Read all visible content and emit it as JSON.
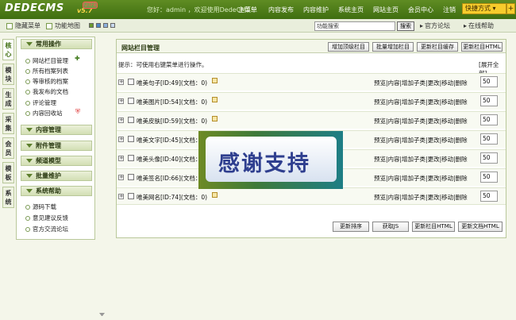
{
  "header": {
    "logo": "DEDECMS",
    "version": "v5.7",
    "badge": "UTF8",
    "welcome": "您好：admin ，欢迎使用DedeCMS！",
    "nav": [
      "主菜单",
      "内容发布",
      "内容维护",
      "系统主页",
      "网站主页",
      "会员中心",
      "注销"
    ],
    "quick_label": "快捷方式",
    "quick_plus": "+"
  },
  "subbar": {
    "hide_menu": "隐藏菜单",
    "site_map": "功能地图",
    "search_value": "功能搜索",
    "search_button": "搜索",
    "official_forum": "官方论坛",
    "online_help": "在线帮助"
  },
  "vtabs": [
    "核心",
    "模块",
    "生成",
    "采集",
    "会员",
    "模板",
    "系统"
  ],
  "leftmenu": {
    "groups": [
      "常用操作",
      "内容管理",
      "附件管理",
      "频道模型",
      "批量维护",
      "系统帮助"
    ],
    "common_items": [
      "网站栏目管理",
      "所有档案列表",
      "等审核的档案",
      "我发布的文档",
      "评论管理",
      "内容回收站"
    ],
    "help_items": [
      "源码下载",
      "意见建议反馈",
      "官方交流论坛"
    ]
  },
  "main": {
    "title": "网站栏目管理",
    "buttons": [
      "增加顶级栏目",
      "批量增加栏目",
      "更新栏目缓存",
      "更新栏目HTML"
    ],
    "tip": "提示：可使用右键菜单进行操作。",
    "expand_all": "[展开全部]",
    "rows": [
      {
        "name": "唯美句子[ID:49](文档：0)",
        "ops": "预览|内容|增加子类|更改|移动|删除",
        "sort": "50"
      },
      {
        "name": "唯美图片[ID:54](文档：0)",
        "ops": "预览|内容|增加子类|更改|移动|删除",
        "sort": "50"
      },
      {
        "name": "唯美皮肤[ID:59](文档：0)",
        "ops": "预览|内容|增加子类|更改|移动|删除",
        "sort": "50"
      },
      {
        "name": "唯美文字[ID:45](文档：0)",
        "ops": "预览|内容|增加子类|更改|移动|删除",
        "sort": "50"
      },
      {
        "name": "唯美头像[ID:40](文档：0)",
        "ops": "预览|内容|增加子类|更改|移动|删除",
        "sort": "50"
      },
      {
        "name": "唯美签名[ID:66](文档：0)",
        "ops": "预览|内容|增加子类|更改|移动|删除",
        "sort": "50"
      },
      {
        "name": "唯美网名[ID:74](文档：0)",
        "ops": "预览|内容|增加子类|更改|移动|删除",
        "sort": "50"
      }
    ],
    "bottom_buttons": [
      "更新排序",
      "获取JS",
      "更新栏目HTML",
      "更新文档HTML"
    ]
  },
  "overlay": {
    "text": "感谢支持"
  },
  "colors": {
    "header_green": "#4a7a18",
    "quick_yellow": "#f7cc2c",
    "panel_border": "#b9c89a",
    "overlay_text": "#2f3f8f"
  }
}
